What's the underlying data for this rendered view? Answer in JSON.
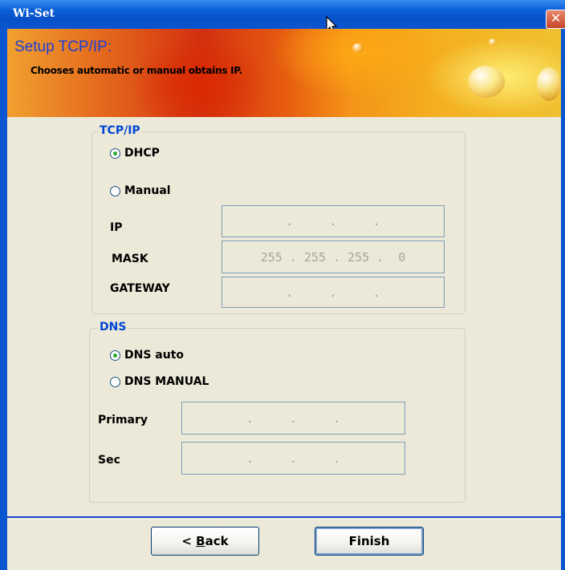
{
  "window": {
    "title": "Wi-Set",
    "close_glyph": "✕"
  },
  "banner": {
    "title": "Setup TCP/IP:",
    "subtitle": "Chooses automatic or manual obtains IP."
  },
  "tcpip": {
    "group_label": "TCP/IP",
    "dhcp_label": "DHCP",
    "manual_label": "Manual",
    "selected": "dhcp",
    "ip_label": "IP",
    "ip_value": ".     .     .",
    "mask_label": "MASK",
    "mask_value": "255 . 255 . 255 .  0",
    "gateway_label": "GATEWAY",
    "gateway_value": ".     .     ."
  },
  "dns": {
    "group_label": "DNS",
    "auto_label": "DNS auto",
    "manual_label": "DNS MANUAL",
    "selected": "auto",
    "primary_label": "Primary",
    "primary_value": ".     .     .",
    "sec_label": "Sec",
    "sec_value": ".     .     ."
  },
  "buttons": {
    "back_prefix": "< ",
    "back_mnemonic": "B",
    "back_rest": "ack",
    "finish_label": "Finish"
  },
  "icons": [
    "close-icon",
    "cursor-icon",
    "radio-selected-icon",
    "radio-unselected-icon"
  ]
}
